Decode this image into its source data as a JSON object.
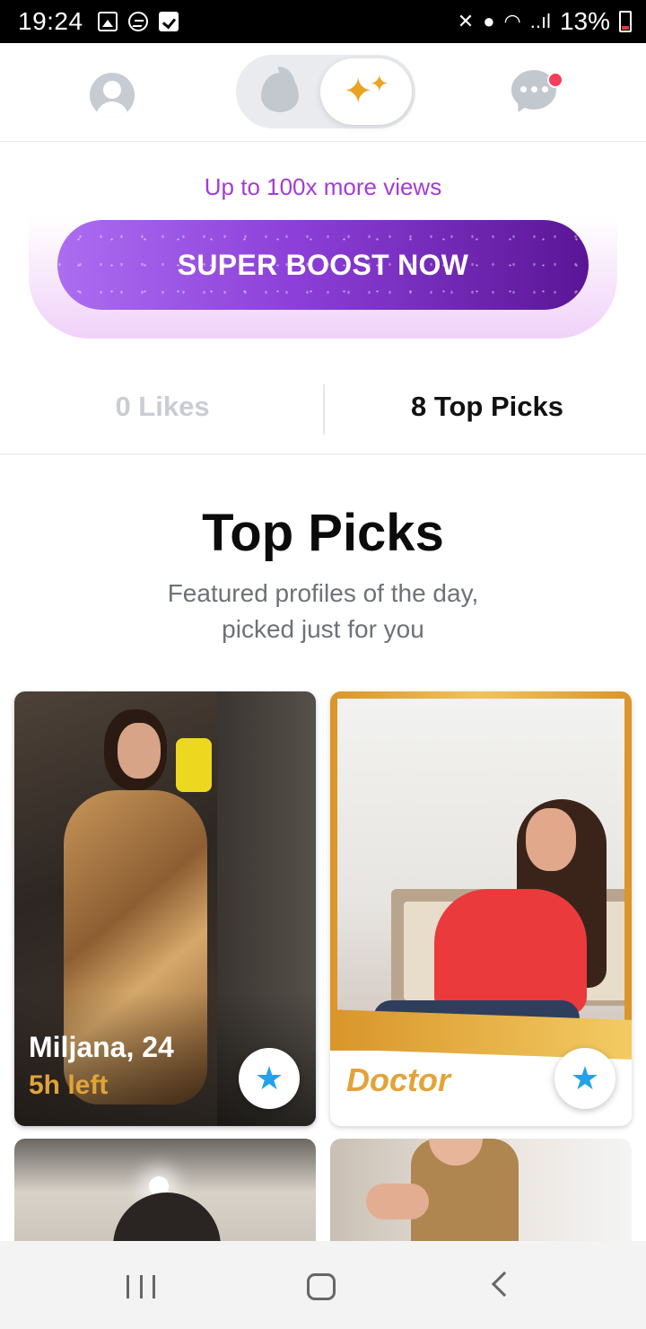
{
  "status_bar": {
    "time": "19:24",
    "signal_label": "..ıl",
    "battery": "13%"
  },
  "top_nav": {
    "active_tab": "gold",
    "has_notification": true
  },
  "promo": {
    "subtitle": "Up to 100x more views",
    "button_label": "SUPER BOOST NOW"
  },
  "tabs": {
    "likes": "0 Likes",
    "top_picks": "8 Top Picks",
    "selected": "top_picks"
  },
  "section": {
    "title": "Top Picks",
    "subtitle_line1": "Featured profiles of the day,",
    "subtitle_line2": "picked just for you"
  },
  "cards": [
    {
      "name": "Miljana, 24",
      "time_left": "5h left"
    },
    {
      "job": "Doctor"
    }
  ],
  "colors": {
    "accent_gold": "#e2a33a",
    "boost_purple": "#8c3fd8",
    "promo_text": "#a43bd6",
    "star_blue": "#1fa3ec",
    "notification_red": "#f53e5b"
  }
}
